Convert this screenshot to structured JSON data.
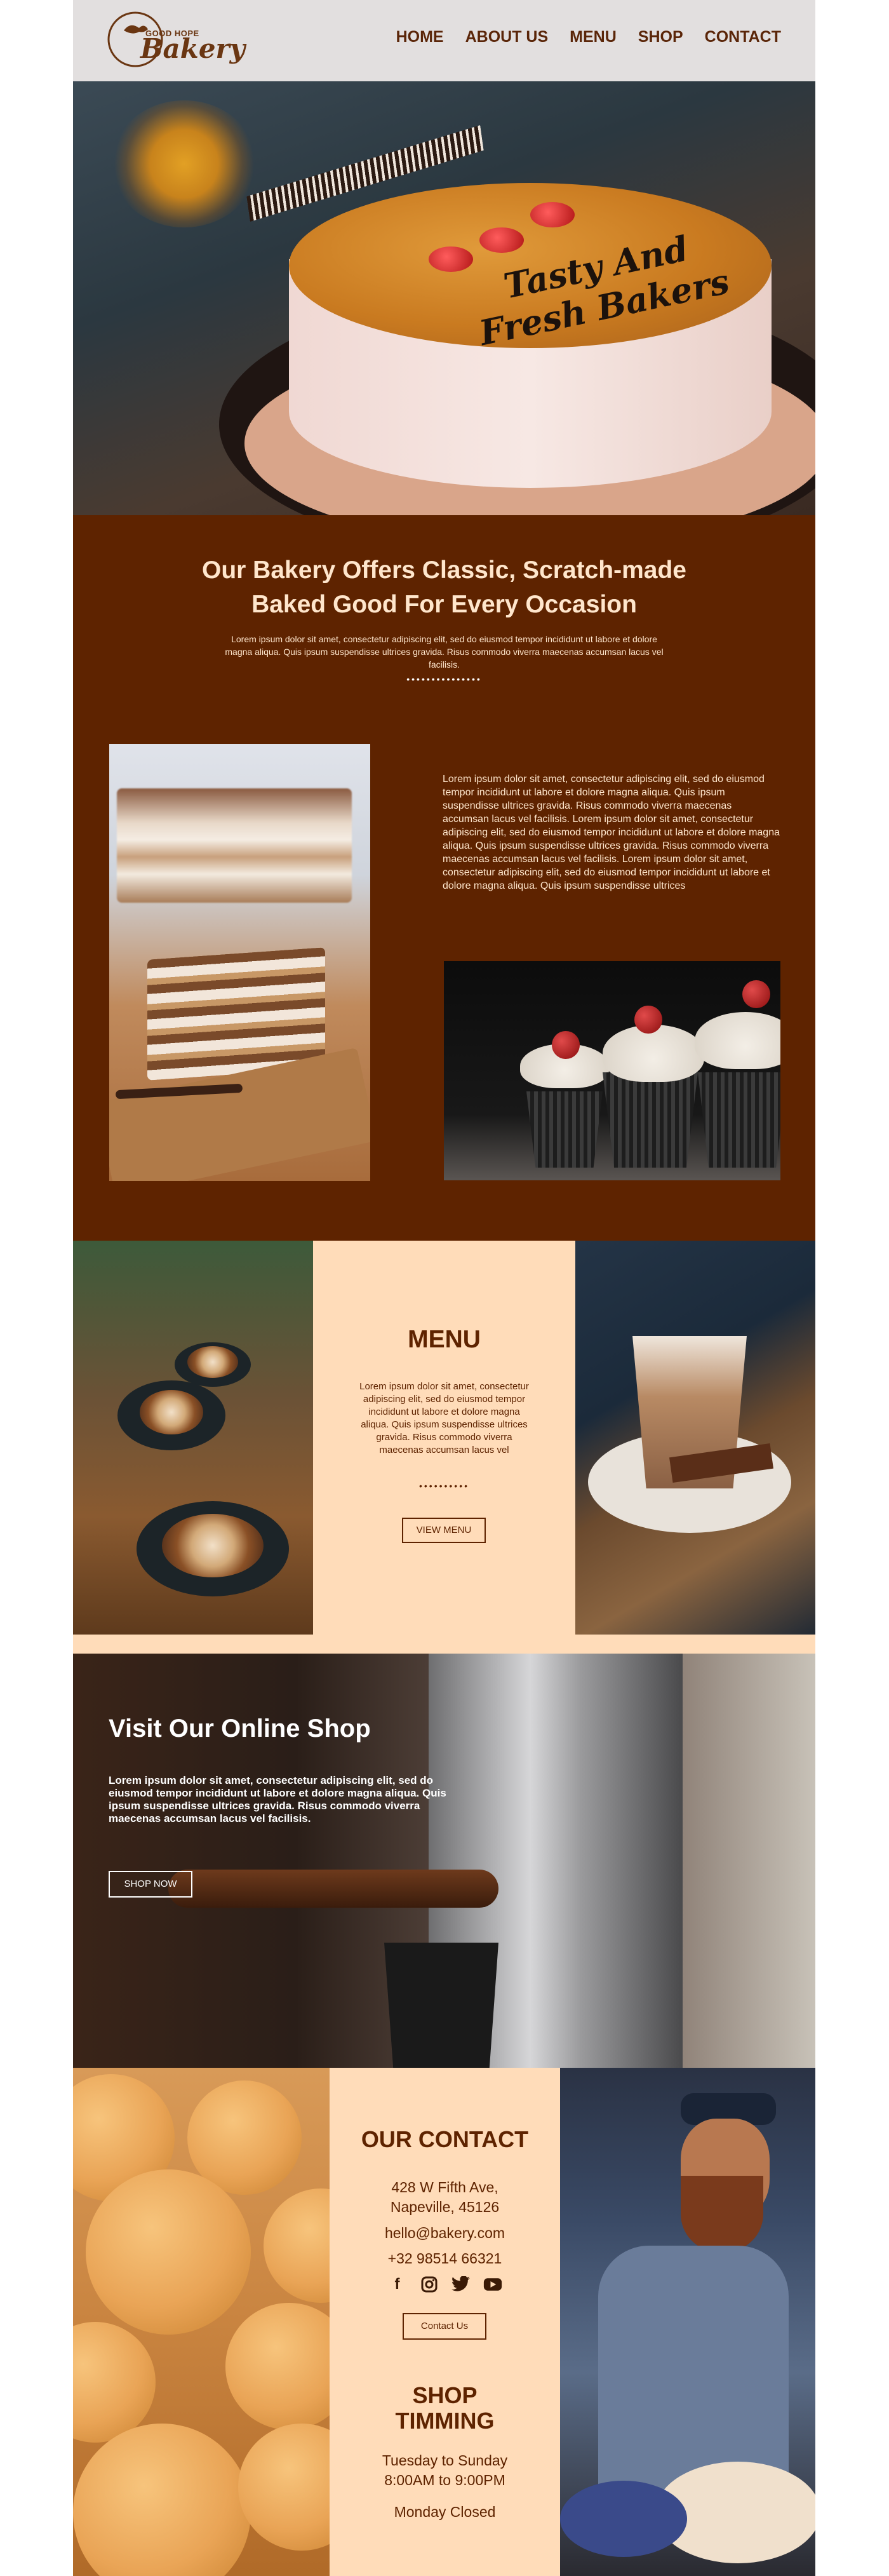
{
  "brand": {
    "logo_top": "GOOD HOPE",
    "logo_main": "Bakery"
  },
  "nav": {
    "items": [
      "HOME",
      "ABOUT US",
      "MENU",
      "SHOP",
      "CONTACT"
    ]
  },
  "hero": {
    "tagline": "Tasty And Fresh Bakers"
  },
  "intro": {
    "title_line1": "Our Bakery Offers Classic, Scratch-made",
    "title_line2": "Baked Good For Every Occasion",
    "text": "Lorem ipsum dolor sit amet, consectetur adipiscing elit, sed do eiusmod tempor incididunt ut labore et dolore magna aliqua. Quis ipsum suspendisse ultrices gravida. Risus commodo viverra maecenas accumsan lacus vel facilisis.",
    "dots": "•••••••••••••••",
    "paragraph": "Lorem ipsum dolor sit amet, consectetur adipiscing elit, sed do eiusmod tempor incididunt ut labore et dolore magna aliqua. Quis ipsum suspendisse ultrices gravida. Risus commodo viverra maecenas accumsan lacus vel facilisis. Lorem ipsum dolor sit amet, consectetur adipiscing elit, sed do eiusmod tempor incididunt ut labore et dolore magna aliqua. Quis ipsum suspendisse ultrices gravida. Risus commodo viverra maecenas accumsan lacus vel facilisis. Lorem ipsum dolor sit amet, consectetur adipiscing elit, sed do eiusmod tempor incididunt ut labore et dolore magna aliqua. Quis ipsum suspendisse ultrices"
  },
  "menu": {
    "title": "MENU",
    "text": "Lorem ipsum dolor sit amet, consectetur adipiscing elit, sed do eiusmod tempor incididunt ut labore et dolore magna aliqua. Quis ipsum suspendisse ultrices gravida. Risus commodo viverra maecenas accumsan lacus vel",
    "dots": "••••••••••",
    "button": "VIEW MENU"
  },
  "shop": {
    "title": "Visit Our Online Shop",
    "text": "Lorem ipsum dolor sit amet, consectetur adipiscing elit, sed do eiusmod tempor incididunt ut labore et dolore magna aliqua. Quis ipsum suspendisse ultrices gravida. Risus commodo viverra maecenas accumsan lacus vel facilisis.",
    "button": "SHOP NOW"
  },
  "contact": {
    "title": "OUR CONTACT",
    "address_line1": "428 W Fifth Ave,",
    "address_line2": "Napeville, 45126",
    "email": "hello@bakery.com",
    "phone": "+32 98514 66321",
    "icons": [
      "facebook-icon",
      "instagram-icon",
      "twitter-icon",
      "youtube-icon"
    ],
    "button": "Contact Us",
    "timing_title_line1": "SHOP",
    "timing_title_line2": "TIMMING",
    "days": "Tuesday to Sunday",
    "hours": "8:00AM to 9:00PM",
    "closed": "Monday Closed"
  },
  "colors": {
    "brown": "#5e2300",
    "cream": "#ffdcb9",
    "header_bg": "#e2dfdf"
  }
}
